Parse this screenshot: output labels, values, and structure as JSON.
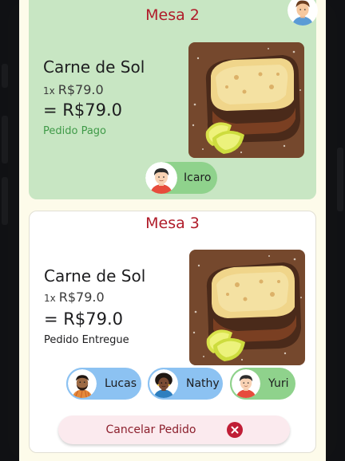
{
  "theme": {
    "paid_card_bg": "#c8e6c3",
    "table_title_color": "#b01c2a",
    "paid_status_color": "#3f9a48",
    "chip_blue": "#8cc2f2",
    "chip_green": "#8fd28c",
    "cancel_bg": "#fbeaee",
    "cancel_icon_color": "#c01e36"
  },
  "orders": [
    {
      "table": "Mesa 2",
      "dish": "Carne de Sol",
      "qty": "1x",
      "unit_price": "R$79.0",
      "total": "= R$79.0",
      "status": "Pedido Pago",
      "photo_icon": "carne-de-sol-photo",
      "clients": [
        {
          "name": "Icaro",
          "avatar": "avatar-icaro-icon"
        }
      ]
    },
    {
      "table": "Mesa 3",
      "dish": "Carne de Sol",
      "qty": "1x",
      "unit_price": "R$79.0",
      "total": "= R$79.0",
      "status": "Pedido Entregue",
      "photo_icon": "carne-de-sol-photo",
      "clients": [
        {
          "name": "Lucas",
          "avatar": "avatar-lucas-icon"
        },
        {
          "name": "Nathy",
          "avatar": "avatar-nathy-icon"
        },
        {
          "name": "Yuri",
          "avatar": "avatar-yuri-icon"
        }
      ],
      "cancel_label": "Cancelar Pedido",
      "cancel_icon": "close-circle-icon"
    }
  ],
  "header": {
    "user_avatar": "user-avatar-icon"
  }
}
